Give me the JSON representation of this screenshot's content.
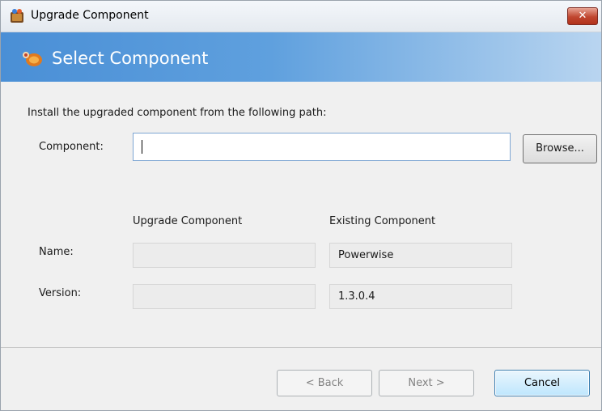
{
  "window": {
    "title": "Upgrade Component",
    "close_glyph": "✕",
    "icon": "component-app-icon"
  },
  "header": {
    "title": "Select Component",
    "icon": "component-wizard-icon"
  },
  "body": {
    "instruction": "Install the upgraded component from the following path:",
    "component_label": "Component:",
    "component_value": "",
    "browse_label": "Browse...",
    "col_upgrade": "Upgrade Component",
    "col_existing": "Existing Component",
    "name_label": "Name:",
    "version_label": "Version:",
    "upgrade_name": "",
    "upgrade_version": "",
    "existing_name": "Powerwise",
    "existing_version": "1.3.0.4"
  },
  "footer": {
    "back_label": "< Back",
    "next_label": "Next >",
    "cancel_label": "Cancel"
  },
  "colors": {
    "header_blue": "#4a8fd6",
    "close_red": "#c0462f",
    "focus_border": "#3c7fb1"
  }
}
